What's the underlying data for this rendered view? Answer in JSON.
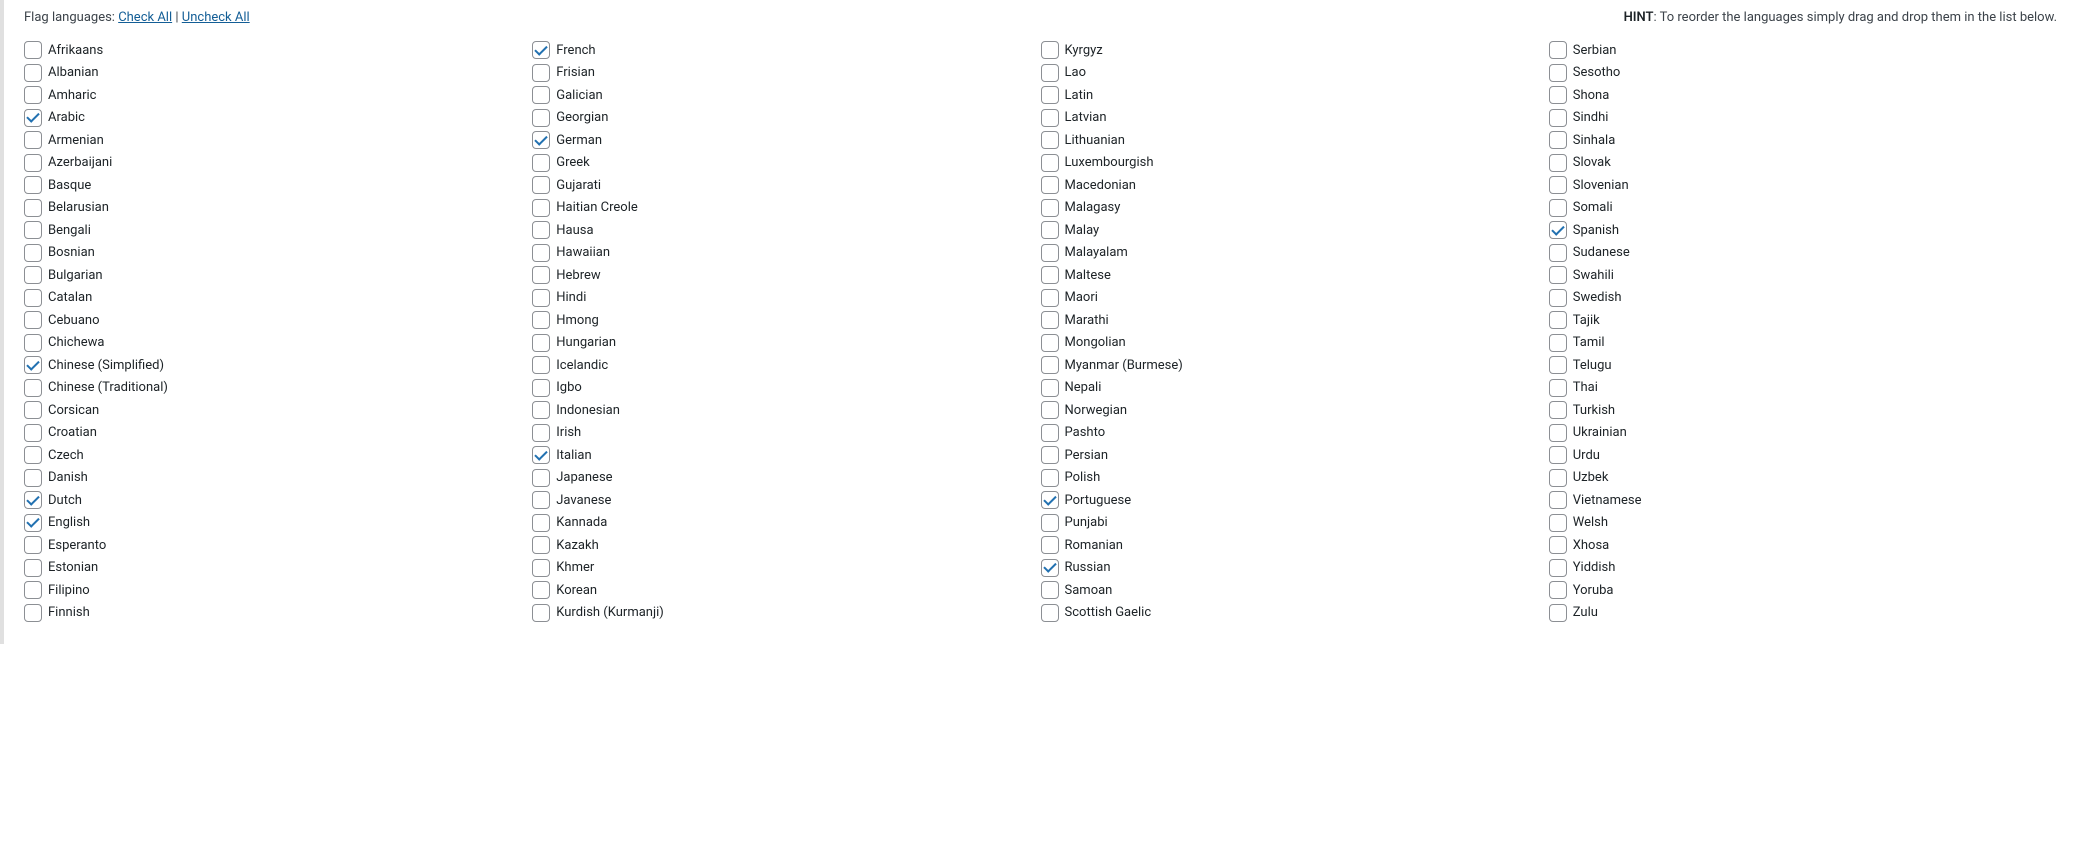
{
  "header": {
    "flag_languages_label": "Flag languages:",
    "check_all": "Check All",
    "separator": "|",
    "uncheck_all": "Uncheck All",
    "hint_prefix": "HINT",
    "hint_text": ": To reorder the languages simply drag and drop them in the list below."
  },
  "columns": [
    [
      {
        "label": "Afrikaans",
        "checked": false
      },
      {
        "label": "Albanian",
        "checked": false
      },
      {
        "label": "Amharic",
        "checked": false
      },
      {
        "label": "Arabic",
        "checked": true
      },
      {
        "label": "Armenian",
        "checked": false
      },
      {
        "label": "Azerbaijani",
        "checked": false
      },
      {
        "label": "Basque",
        "checked": false
      },
      {
        "label": "Belarusian",
        "checked": false
      },
      {
        "label": "Bengali",
        "checked": false
      },
      {
        "label": "Bosnian",
        "checked": false
      },
      {
        "label": "Bulgarian",
        "checked": false
      },
      {
        "label": "Catalan",
        "checked": false
      },
      {
        "label": "Cebuano",
        "checked": false
      },
      {
        "label": "Chichewa",
        "checked": false
      },
      {
        "label": "Chinese (Simplified)",
        "checked": true
      },
      {
        "label": "Chinese (Traditional)",
        "checked": false
      },
      {
        "label": "Corsican",
        "checked": false
      },
      {
        "label": "Croatian",
        "checked": false
      },
      {
        "label": "Czech",
        "checked": false
      },
      {
        "label": "Danish",
        "checked": false
      },
      {
        "label": "Dutch",
        "checked": true
      },
      {
        "label": "English",
        "checked": true
      },
      {
        "label": "Esperanto",
        "checked": false
      },
      {
        "label": "Estonian",
        "checked": false
      },
      {
        "label": "Filipino",
        "checked": false
      },
      {
        "label": "Finnish",
        "checked": false
      }
    ],
    [
      {
        "label": "French",
        "checked": true
      },
      {
        "label": "Frisian",
        "checked": false
      },
      {
        "label": "Galician",
        "checked": false
      },
      {
        "label": "Georgian",
        "checked": false
      },
      {
        "label": "German",
        "checked": true
      },
      {
        "label": "Greek",
        "checked": false
      },
      {
        "label": "Gujarati",
        "checked": false
      },
      {
        "label": "Haitian Creole",
        "checked": false
      },
      {
        "label": "Hausa",
        "checked": false
      },
      {
        "label": "Hawaiian",
        "checked": false
      },
      {
        "label": "Hebrew",
        "checked": false
      },
      {
        "label": "Hindi",
        "checked": false
      },
      {
        "label": "Hmong",
        "checked": false
      },
      {
        "label": "Hungarian",
        "checked": false
      },
      {
        "label": "Icelandic",
        "checked": false
      },
      {
        "label": "Igbo",
        "checked": false
      },
      {
        "label": "Indonesian",
        "checked": false
      },
      {
        "label": "Irish",
        "checked": false
      },
      {
        "label": "Italian",
        "checked": true
      },
      {
        "label": "Japanese",
        "checked": false
      },
      {
        "label": "Javanese",
        "checked": false
      },
      {
        "label": "Kannada",
        "checked": false
      },
      {
        "label": "Kazakh",
        "checked": false
      },
      {
        "label": "Khmer",
        "checked": false
      },
      {
        "label": "Korean",
        "checked": false
      },
      {
        "label": "Kurdish (Kurmanji)",
        "checked": false
      }
    ],
    [
      {
        "label": "Kyrgyz",
        "checked": false
      },
      {
        "label": "Lao",
        "checked": false
      },
      {
        "label": "Latin",
        "checked": false
      },
      {
        "label": "Latvian",
        "checked": false
      },
      {
        "label": "Lithuanian",
        "checked": false
      },
      {
        "label": "Luxembourgish",
        "checked": false
      },
      {
        "label": "Macedonian",
        "checked": false
      },
      {
        "label": "Malagasy",
        "checked": false
      },
      {
        "label": "Malay",
        "checked": false
      },
      {
        "label": "Malayalam",
        "checked": false
      },
      {
        "label": "Maltese",
        "checked": false
      },
      {
        "label": "Maori",
        "checked": false
      },
      {
        "label": "Marathi",
        "checked": false
      },
      {
        "label": "Mongolian",
        "checked": false
      },
      {
        "label": "Myanmar (Burmese)",
        "checked": false
      },
      {
        "label": "Nepali",
        "checked": false
      },
      {
        "label": "Norwegian",
        "checked": false
      },
      {
        "label": "Pashto",
        "checked": false
      },
      {
        "label": "Persian",
        "checked": false
      },
      {
        "label": "Polish",
        "checked": false
      },
      {
        "label": "Portuguese",
        "checked": true
      },
      {
        "label": "Punjabi",
        "checked": false
      },
      {
        "label": "Romanian",
        "checked": false
      },
      {
        "label": "Russian",
        "checked": true
      },
      {
        "label": "Samoan",
        "checked": false
      },
      {
        "label": "Scottish Gaelic",
        "checked": false
      }
    ],
    [
      {
        "label": "Serbian",
        "checked": false
      },
      {
        "label": "Sesotho",
        "checked": false
      },
      {
        "label": "Shona",
        "checked": false
      },
      {
        "label": "Sindhi",
        "checked": false
      },
      {
        "label": "Sinhala",
        "checked": false
      },
      {
        "label": "Slovak",
        "checked": false
      },
      {
        "label": "Slovenian",
        "checked": false
      },
      {
        "label": "Somali",
        "checked": false
      },
      {
        "label": "Spanish",
        "checked": true
      },
      {
        "label": "Sudanese",
        "checked": false
      },
      {
        "label": "Swahili",
        "checked": false
      },
      {
        "label": "Swedish",
        "checked": false
      },
      {
        "label": "Tajik",
        "checked": false
      },
      {
        "label": "Tamil",
        "checked": false
      },
      {
        "label": "Telugu",
        "checked": false
      },
      {
        "label": "Thai",
        "checked": false
      },
      {
        "label": "Turkish",
        "checked": false
      },
      {
        "label": "Ukrainian",
        "checked": false
      },
      {
        "label": "Urdu",
        "checked": false
      },
      {
        "label": "Uzbek",
        "checked": false
      },
      {
        "label": "Vietnamese",
        "checked": false
      },
      {
        "label": "Welsh",
        "checked": false
      },
      {
        "label": "Xhosa",
        "checked": false
      },
      {
        "label": "Yiddish",
        "checked": false
      },
      {
        "label": "Yoruba",
        "checked": false
      },
      {
        "label": "Zulu",
        "checked": false
      }
    ]
  ]
}
